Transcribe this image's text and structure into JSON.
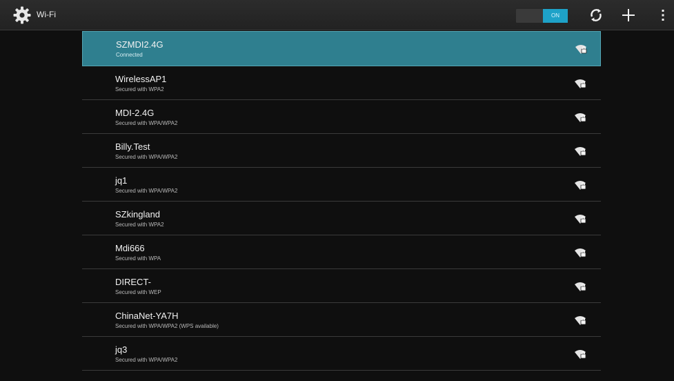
{
  "action_bar": {
    "title": "Wi-Fi",
    "app_icon": "settings-gear-icon",
    "switch_label": "ON",
    "switch_color": "#1ea2c8",
    "scan_icon": "wps-scan-icon",
    "add_icon": "add-network-icon",
    "menu_icon": "overflow-menu-icon"
  },
  "networks": [
    {
      "ssid": "SZMDI2.4G",
      "status": "Connected",
      "icon": "wifi-signal-lock-icon"
    },
    {
      "ssid": "WirelessAP1",
      "status": "Secured with WPA2",
      "icon": "wifi-signal-lock-icon"
    },
    {
      "ssid": "MDI-2.4G",
      "status": "Secured with WPA/WPA2",
      "icon": "wifi-signal-lock-icon"
    },
    {
      "ssid": "Billy.Test",
      "status": "Secured with WPA/WPA2",
      "icon": "wifi-signal-lock-icon"
    },
    {
      "ssid": "jq1",
      "status": "Secured with WPA/WPA2",
      "icon": "wifi-signal-lock-icon"
    },
    {
      "ssid": "SZkingland",
      "status": "Secured with WPA2",
      "icon": "wifi-signal-lock-icon"
    },
    {
      "ssid": "Mdi666",
      "status": "Secured with WPA",
      "icon": "wifi-signal-lock-icon"
    },
    {
      "ssid": "DIRECT-",
      "status": "Secured with WEP",
      "icon": "wifi-signal-lock-icon"
    },
    {
      "ssid": "ChinaNet-YA7H",
      "status": "Secured with WPA/WPA2 (WPS available)",
      "icon": "wifi-signal-lock-icon"
    },
    {
      "ssid": "jq3",
      "status": "Secured with WPA/WPA2",
      "icon": "wifi-signal-lock-icon"
    }
  ],
  "colors": {
    "selected_row": "#2f7f8f",
    "background": "#0f0f0f",
    "divider": "#3b3b3b"
  }
}
